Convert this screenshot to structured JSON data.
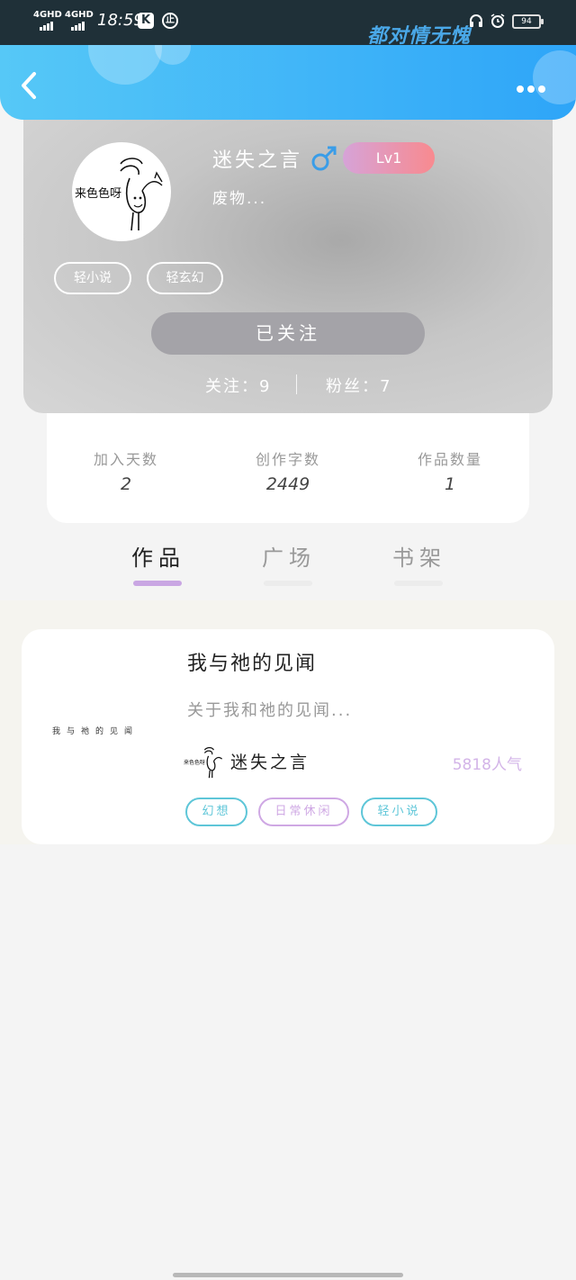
{
  "status_bar": {
    "network1": "4GHD",
    "network2": "4GHD",
    "time": "18:59",
    "app_badge": "K",
    "circle_icon_text": "止",
    "overlay_text": "都对情无愧",
    "battery": "94"
  },
  "header": {
    "back_icon": "chevron-left",
    "more_icon": "more-horizontal"
  },
  "profile": {
    "avatar_text": "来色色呀",
    "username": "迷失之言",
    "gender_symbol": "♂",
    "level": "Lv1",
    "bio": "废物...",
    "tags": [
      "轻小说",
      "轻玄幻"
    ],
    "follow_button": "已关注",
    "following": "关注：9",
    "fans": "粉丝：7"
  },
  "stats": [
    {
      "label": "加入天数",
      "value": "2"
    },
    {
      "label": "创作字数",
      "value": "2449"
    },
    {
      "label": "作品数量",
      "value": "1"
    }
  ],
  "tabs": [
    {
      "label": "作品",
      "active": true
    },
    {
      "label": "广场",
      "active": false
    },
    {
      "label": "书架",
      "active": false
    }
  ],
  "work": {
    "cover_title": "我与祂的见闻",
    "title": "我与祂的见闻",
    "description": "关于我和祂的见闻...",
    "author_avatar_text": "来色色呀",
    "author": "迷失之言",
    "popularity": "5818人气",
    "tags": [
      {
        "label": "幻想",
        "color": "#5ec6d8"
      },
      {
        "label": "日常休闲",
        "color": "#cfa8e4"
      },
      {
        "label": "轻小说",
        "color": "#5ec6d8"
      }
    ]
  },
  "colors": {
    "header_start": "#56c8f7",
    "header_end": "#2ea5f8",
    "tab_indicator": "#c9a6e3",
    "gender_blue": "#3a9de8"
  }
}
